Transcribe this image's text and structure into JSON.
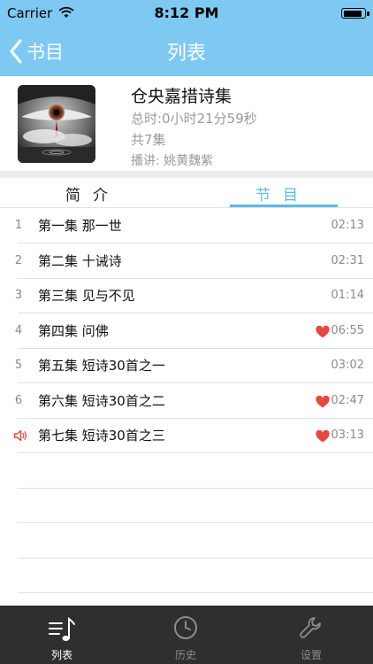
{
  "status_bar": {
    "carrier": "Carrier",
    "time": "8:12 PM",
    "battery_level": 0.9
  },
  "nav": {
    "back_label": "书目",
    "title": "列表"
  },
  "album": {
    "title": "仓央嘉措诗集",
    "total_duration": "总时:0小时21分59秒",
    "episode_count": "共7集",
    "narrator": "播讲:  姚黄魏紫"
  },
  "tabs": {
    "intro": "简介",
    "episodes": "节目",
    "active": "episodes"
  },
  "episodes": [
    {
      "number": "1",
      "title": "第一集 那一世",
      "duration": "02:13",
      "favorite": false,
      "playing": false
    },
    {
      "number": "2",
      "title": "第二集 十诫诗",
      "duration": "02:31",
      "favorite": false,
      "playing": false
    },
    {
      "number": "3",
      "title": "第三集 见与不见",
      "duration": "01:14",
      "favorite": false,
      "playing": false
    },
    {
      "number": "4",
      "title": "第四集 问佛",
      "duration": "06:55",
      "favorite": true,
      "playing": false
    },
    {
      "number": "5",
      "title": "第五集 短诗30首之一",
      "duration": "03:02",
      "favorite": false,
      "playing": false
    },
    {
      "number": "6",
      "title": "第六集 短诗30首之二",
      "duration": "02:47",
      "favorite": true,
      "playing": false
    },
    {
      "number": "7",
      "title": "第七集 短诗30首之三",
      "duration": "03:13",
      "favorite": true,
      "playing": true
    }
  ],
  "tab_bar": {
    "list": "列表",
    "history": "历史",
    "settings": "设置",
    "active": "list"
  },
  "colors": {
    "nav_bar": "#7ec9f1",
    "accent": "#5bbbe8",
    "heart": "#e8473f",
    "tab_bar": "#2f2f2f"
  }
}
